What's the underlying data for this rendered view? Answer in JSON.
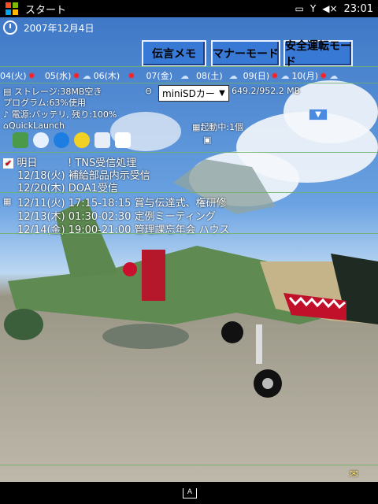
{
  "status_bar": {
    "title": "スタート",
    "time": "23:01",
    "icons": [
      "windows-start-icon",
      "battery-icon",
      "signal-off-icon",
      "volume-mute-icon"
    ]
  },
  "header": {
    "date": "2007年12月4日",
    "buttons": [
      "伝言メモ",
      "マナーモード",
      "安全運転モード"
    ]
  },
  "weather": {
    "days": [
      "04(火)",
      "05(水)",
      "06(木)",
      "07(金)",
      "08(土)",
      "09(日)",
      "10(月)"
    ]
  },
  "system": {
    "storage": "ストレージ:38MB空き",
    "program": "プログラム:63%使用",
    "power": "電源:バッテリ, 残り:100%",
    "card_select": "miniSDカード",
    "card_space": "649.2/952.2 MB",
    "quicklaunch": "QuickLaunch",
    "running": "起動中:1個"
  },
  "tasks": {
    "header": "明日",
    "items": [
      "! TNS受信処理",
      "12/18(火)  補給部品内示受信",
      "12/20(木)  DOA1受信"
    ]
  },
  "calendar": {
    "items": [
      "12/11(火) 17:15-18:15 賞与伝達式、権研修",
      "12/13(木) 01:30-02:30 定例ミーティング",
      "12/14(金) 19:00-21:00 管理課忘年会 ハウス"
    ]
  },
  "colors": {
    "button_bg": "#3979d6",
    "sun": "#ff2020",
    "divider": "#6fb06f"
  }
}
